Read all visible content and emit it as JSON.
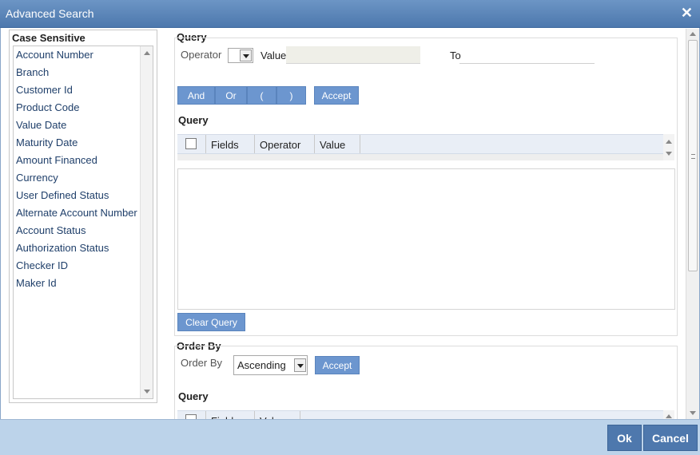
{
  "window": {
    "title": "Advanced Search",
    "close_glyph": "✕"
  },
  "left_panel": {
    "title": "Case Sensitive",
    "fields": [
      "Account Number",
      "Branch",
      "Customer Id",
      "Product Code",
      "Value Date",
      "Maturity Date",
      "Amount Financed",
      "Currency",
      "User Defined Status",
      "Alternate Account Number",
      "Account Status",
      "Authorization Status",
      "Checker ID",
      "Maker Id"
    ]
  },
  "query_section": {
    "title": "Query",
    "operator_label": "Operator",
    "value_label": "Value",
    "to_label": "To",
    "value_input": "",
    "to_input": "",
    "buttons": {
      "and": "And",
      "or": "Or",
      "open_paren": "(",
      "close_paren": ")",
      "accept": "Accept"
    },
    "grid_title": "Query",
    "grid_columns": [
      "Fields",
      "Operator",
      "Value"
    ],
    "clear_button": "Clear Query"
  },
  "order_section": {
    "title": "Order By",
    "order_label": "Order By",
    "selected_order": "Ascending",
    "accept_button": "Accept",
    "grid_title": "Query",
    "grid_columns": [
      "Fields",
      "Value"
    ]
  },
  "footer": {
    "ok": "Ok",
    "cancel": "Cancel"
  },
  "colors": {
    "title_bar": "#5a84b8",
    "button": "#6c96cf",
    "footer": "#bcd3ea",
    "footer_button": "#4e78ad"
  }
}
